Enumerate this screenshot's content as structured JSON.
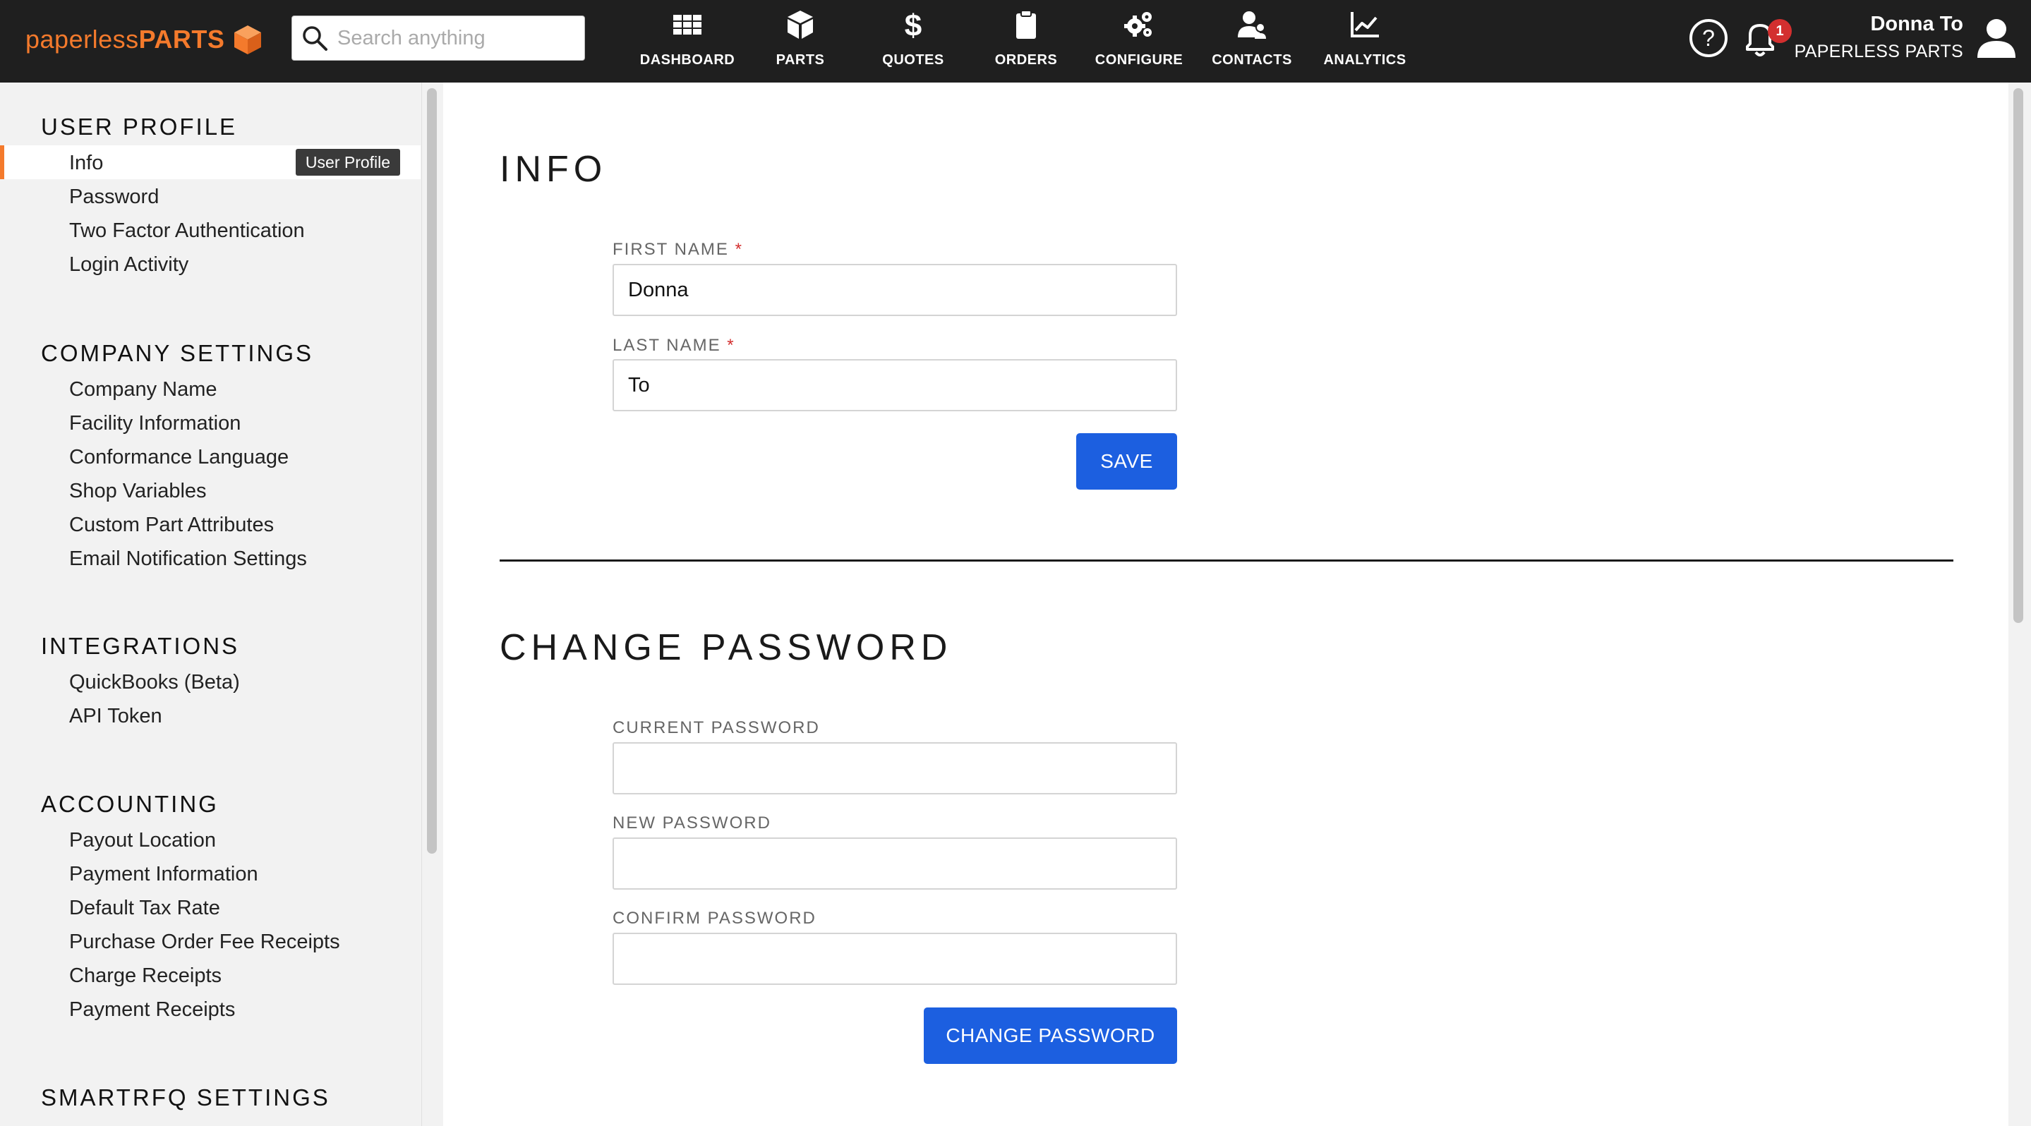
{
  "brand": {
    "name_light": "paperless",
    "name_bold": "PARTS",
    "accent": "#f47a2c"
  },
  "search": {
    "placeholder": "Search anything"
  },
  "nav": [
    {
      "label": "DASHBOARD",
      "icon": "grid-icon"
    },
    {
      "label": "PARTS",
      "icon": "cube-icon"
    },
    {
      "label": "QUOTES",
      "icon": "dollar-icon"
    },
    {
      "label": "ORDERS",
      "icon": "clipboard-icon"
    },
    {
      "label": "CONFIGURE",
      "icon": "gears-icon"
    },
    {
      "label": "CONTACTS",
      "icon": "users-icon"
    },
    {
      "label": "ANALYTICS",
      "icon": "chart-icon"
    }
  ],
  "header": {
    "notifications_count": "1",
    "user_name": "Donna To",
    "company": "PAPERLESS PARTS"
  },
  "sidebar": {
    "tooltip": "User Profile",
    "sections": [
      {
        "title": "USER PROFILE",
        "items": [
          "Info",
          "Password",
          "Two Factor Authentication",
          "Login Activity"
        ]
      },
      {
        "title": "COMPANY SETTINGS",
        "items": [
          "Company Name",
          "Facility Information",
          "Conformance Language",
          "Shop Variables",
          "Custom Part Attributes",
          "Email Notification Settings"
        ]
      },
      {
        "title": "INTEGRATIONS",
        "items": [
          "QuickBooks (Beta)",
          "API Token"
        ]
      },
      {
        "title": "ACCOUNTING",
        "items": [
          "Payout Location",
          "Payment Information",
          "Default Tax Rate",
          "Purchase Order Fee Receipts",
          "Charge Receipts",
          "Payment Receipts"
        ]
      },
      {
        "title": "SMARTRFQ SETTINGS",
        "items": []
      }
    ],
    "active_item": "Info"
  },
  "info": {
    "title": "INFO",
    "first_name_label": "FIRST NAME",
    "first_name_value": "Donna",
    "last_name_label": "LAST NAME",
    "last_name_value": "To",
    "required_mark": "*",
    "save_label": "SAVE"
  },
  "change_password": {
    "title": "CHANGE PASSWORD",
    "current_label": "CURRENT PASSWORD",
    "new_label": "NEW PASSWORD",
    "confirm_label": "CONFIRM PASSWORD",
    "submit_label": "CHANGE PASSWORD"
  },
  "colors": {
    "primary_button": "#1c5fe0",
    "topbar": "#1f1f1f",
    "badge": "#d32f2f"
  }
}
